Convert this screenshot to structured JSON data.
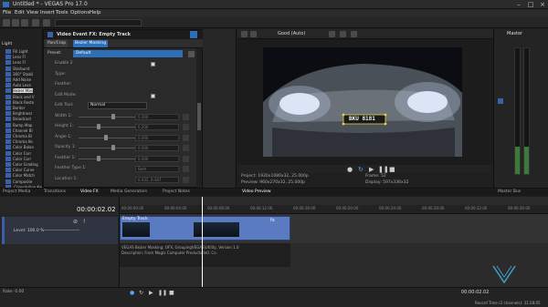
{
  "titlebar": {
    "title": "Untitled * - VEGAS Pro 17.0"
  },
  "menu": [
    "File",
    "Edit",
    "View",
    "Insert",
    "Tools",
    "Options",
    "Help"
  ],
  "tree": {
    "root": "Light",
    "items": [
      "Fill Light",
      "Lens Fl",
      "Lens Fl",
      "Starburst",
      "360° Stabil",
      "Add Noise",
      "Auto Leve",
      "Bezier Mas",
      "Black and V",
      "Black Resto",
      "Border",
      "Brightness",
      "Broadcast",
      "Bump Map",
      "Channel Bl",
      "Chroma Bl",
      "Chroma Ke",
      "Color Balan",
      "Color Corr",
      "Color Corr",
      "Color Grading",
      "Color Curve",
      "Color Match",
      "Composite",
      ".Convolution Kernel"
    ]
  },
  "fx": {
    "header": "Video Event FX: Empty Track",
    "chain": [
      "Pan/Crop",
      "Bezier Masking"
    ],
    "preset_label": "Preset:",
    "preset_value": "Default",
    "rows": [
      {
        "label": "Enable 2"
      },
      {
        "label": "Type:"
      },
      {
        "label": "Feather:"
      },
      {
        "label": "Edit Mode:"
      },
      {
        "label": "Edit Tool:",
        "value": "Normal"
      },
      {
        "label": "Width 1:",
        "value": "0.200"
      },
      {
        "label": "Height 1:",
        "value": "0.200"
      },
      {
        "label": "Angle 1:",
        "value": "0.000"
      },
      {
        "label": "Opacity 1:",
        "value": "0.000"
      },
      {
        "label": "Feather 1:",
        "value": "0.000"
      },
      {
        "label": "Feather Type 1:",
        "value": "Both"
      },
      {
        "label": "Location 1:",
        "value": "0.432, 0.487"
      }
    ]
  },
  "preview": {
    "toolbar": "Good (Auto)",
    "plate": "BKU 8181",
    "info": {
      "project": "Project: 1920x1080x32, 25.000p",
      "preview": "Preview: 960x270x32, 25.000p",
      "display": "Display: 597x336x32",
      "frame": "Frame: 52",
      "video_preview_tab": "Video Preview"
    }
  },
  "master": {
    "title": "Master"
  },
  "tabs": [
    "Project Media",
    "Transitions",
    "Video FX",
    "Media Generators",
    "Project Notes",
    "Video Preview",
    "Master Bus"
  ],
  "timeline": {
    "time": "00:00:02.02",
    "level": "Level: 100.0 %",
    "clip_title": "Empty Track",
    "ruler": [
      "00:00:00:00",
      "00:00:04:00",
      "00:00:08:00",
      "00:00:12:00",
      "00:00:16:00",
      "00:00:20:00",
      "00:00:24:00",
      "00:00:28:00",
      "00:00:32:00",
      "00:00:36:00"
    ],
    "plugin_info_1": "VEGAS Bezier Masking: OFX, GroupingVEGAS\\Utility, Version 1.0",
    "plugin_info_2": "Description: From Magix Computer Products Intl. Co.",
    "transport_time": "00:00:02.02",
    "rate": "Rate: 0.00",
    "record_time": "Record Time (2 channels): 31:28:05"
  }
}
